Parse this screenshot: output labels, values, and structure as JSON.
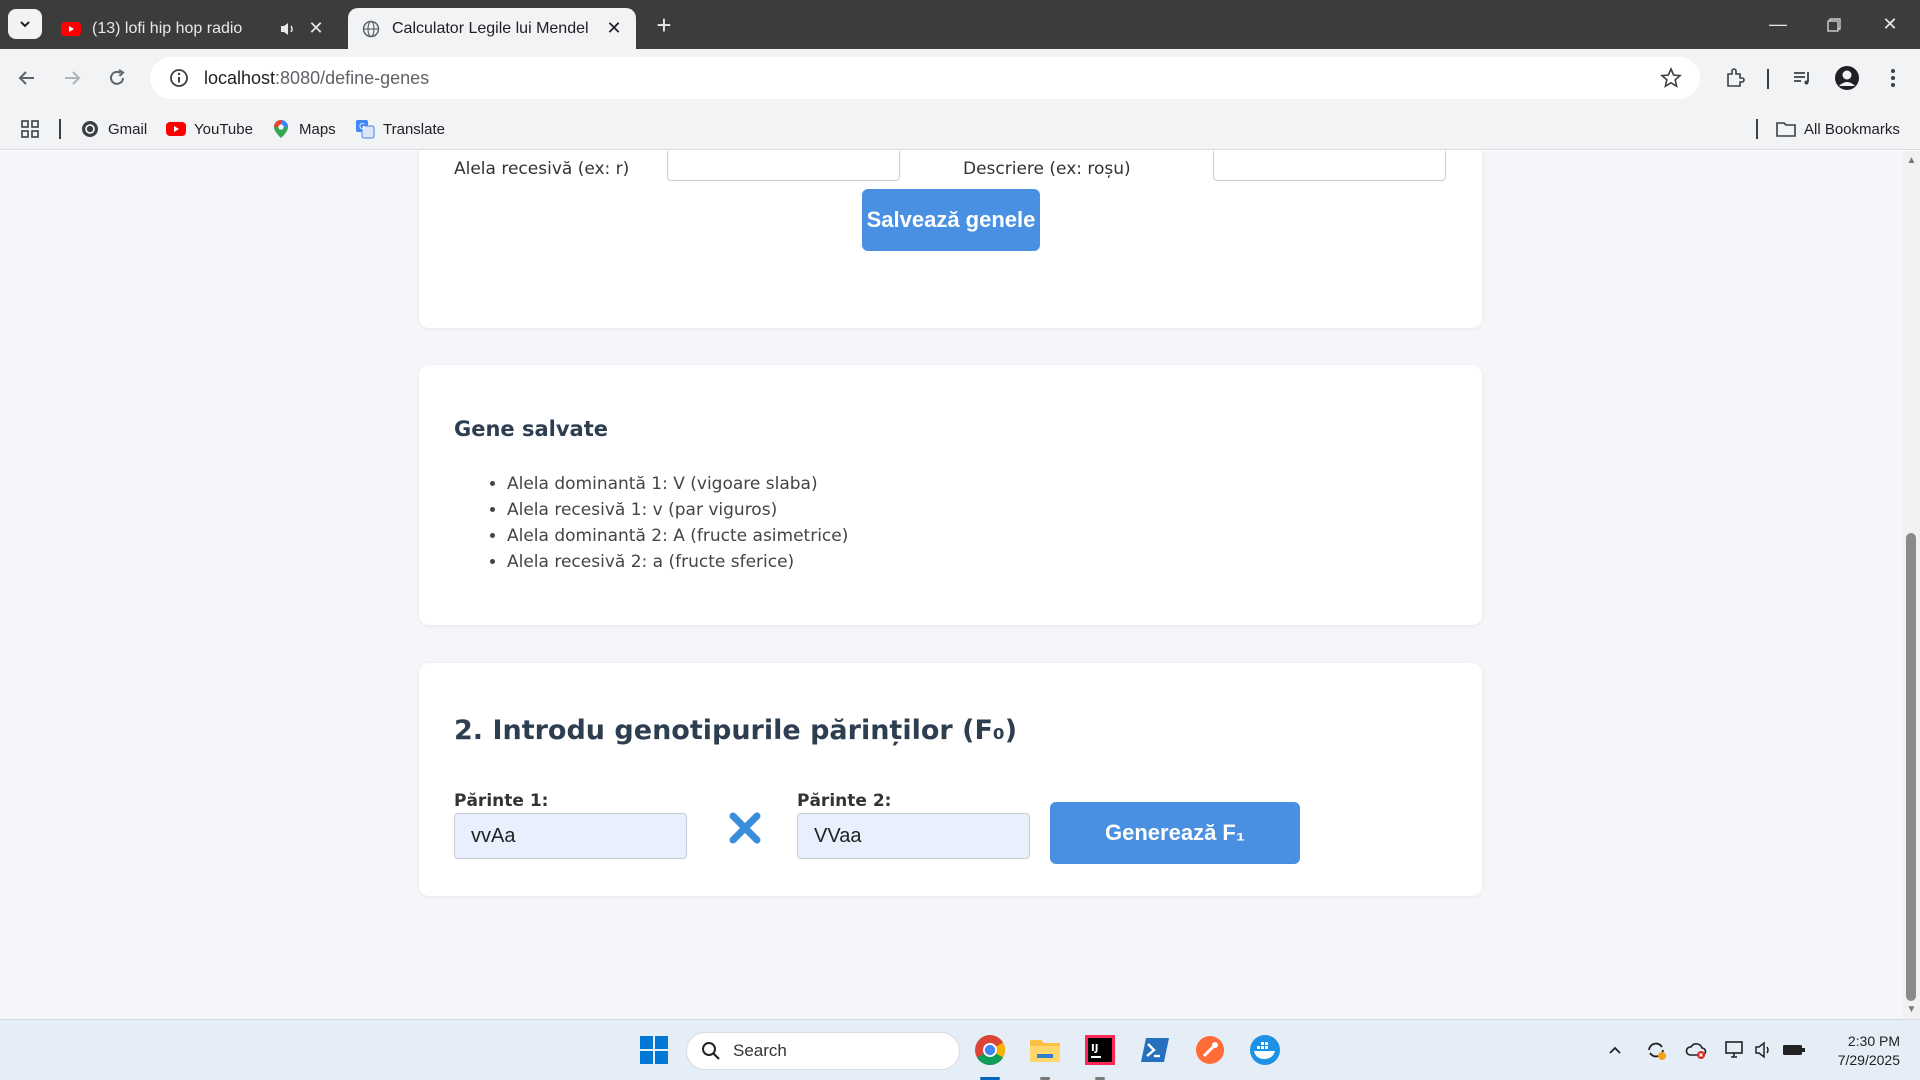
{
  "browser": {
    "tabs": [
      {
        "title": "(13) lofi hip hop radio",
        "favicon": "youtube-icon",
        "audio": "speaker-icon",
        "active": false
      },
      {
        "title": "Calculator Legile lui Mendel",
        "favicon": "globe-icon",
        "active": true
      }
    ],
    "new_tab": "+",
    "url_host": "localhost",
    "url_path": ":8080/define-genes",
    "bookmarks": [
      {
        "label": "Gmail",
        "icon": "gmail-icon"
      },
      {
        "label": "YouTube",
        "icon": "youtube-icon"
      },
      {
        "label": "Maps",
        "icon": "maps-icon"
      },
      {
        "label": "Translate",
        "icon": "translate-icon"
      }
    ],
    "all_bookmarks": "All Bookmarks"
  },
  "define_genes": {
    "recessive_label": "Alela recesivă (ex: r)",
    "description_label": "Descriere (ex: roșu)",
    "recessive_value": "",
    "description_value": "",
    "save_button": "Salvează genele"
  },
  "saved_genes": {
    "title": "Gene salvate",
    "items": [
      "Alela dominantă 1: V (vigoare slaba)",
      "Alela recesivă 1: v (par viguros)",
      "Alela dominantă 2: A (fructe asimetrice)",
      "Alela recesivă 2: a (fructe sferice)"
    ]
  },
  "parents": {
    "title": "2. Introdu genotipurile părinților (F₀)",
    "parent1_label": "Părinte 1:",
    "parent1_value": "vvAa",
    "parent2_label": "Părinte 2:",
    "parent2_value": "VVaa",
    "generate_button": "Generează F₁",
    "cross_symbol": "cross-icon"
  },
  "taskbar": {
    "search_placeholder": "Search",
    "time": "2:30 PM",
    "date": "7/29/2025"
  },
  "colors": {
    "accent": "#4a90e2",
    "heading": "#2c3e50",
    "page_bg": "#f4f6f9",
    "chrome_dark": "#3c3c3c"
  }
}
